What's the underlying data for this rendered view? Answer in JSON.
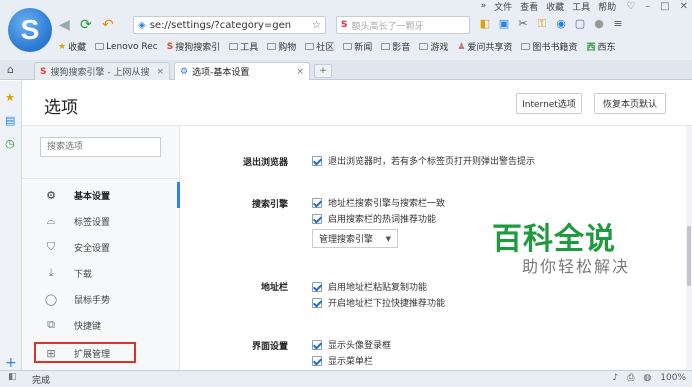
{
  "menu": {
    "items": [
      "文件",
      "查看",
      "收藏",
      "工具",
      "帮助"
    ]
  },
  "address": {
    "text": "se://settings/?category=gen"
  },
  "search": {
    "engine_glyph": "S",
    "placeholder": "额头高长了一颗牙"
  },
  "bookmarks": [
    "收藏",
    "Lenovo Rec",
    "搜狗搜索引",
    "工具",
    "购物",
    "社区",
    "新闻",
    "影音",
    "游戏",
    "爱问共享资",
    "图书书籍资",
    "西东"
  ],
  "tabs": [
    {
      "label": "搜狗搜索引擎 - 上网从搜",
      "close": "×"
    },
    {
      "label": "选项-基本设置",
      "close": "×"
    }
  ],
  "newtab": "+",
  "page": {
    "title": "选项",
    "buttons": {
      "internet": "Internet选项",
      "restore": "恢复本页默认"
    }
  },
  "sidebar": {
    "search_placeholder": "搜索选项",
    "items": [
      {
        "label": "基本设置",
        "icon": "gear-icon"
      },
      {
        "label": "标签设置",
        "icon": "tab-icon"
      },
      {
        "label": "安全设置",
        "icon": "shield-icon"
      },
      {
        "label": "下载",
        "icon": "download-icon"
      },
      {
        "label": "鼠标手势",
        "icon": "mouse-icon"
      },
      {
        "label": "快捷键",
        "icon": "shortcut-icon"
      },
      {
        "label": "扩展管理",
        "icon": "grid-icon"
      }
    ]
  },
  "settings": {
    "exit": {
      "title": "退出浏览器",
      "option": "退出浏览器时，若有多个标签页打开则弹出警告提示"
    },
    "engine": {
      "title": "搜索引擎",
      "options": [
        "地址栏搜索引擎与搜索栏一致",
        "启用搜索栏的热词推荐功能"
      ],
      "manage": "管理搜索引擎"
    },
    "address": {
      "title": "地址栏",
      "options": [
        "启用地址栏粘贴复制功能",
        "开启地址栏下拉快捷推荐功能"
      ]
    },
    "ui": {
      "title": "界面设置",
      "options": [
        "显示头像登录框",
        "显示菜单栏"
      ]
    }
  },
  "watermark": {
    "main": "百科全说",
    "sub": "助你轻松解决"
  },
  "status": {
    "text": "完成",
    "zoom": "100%"
  },
  "colors": {
    "accent": "#2b84e0",
    "highlight_box": "#e0302a",
    "watermark": "#1f9a3e"
  }
}
